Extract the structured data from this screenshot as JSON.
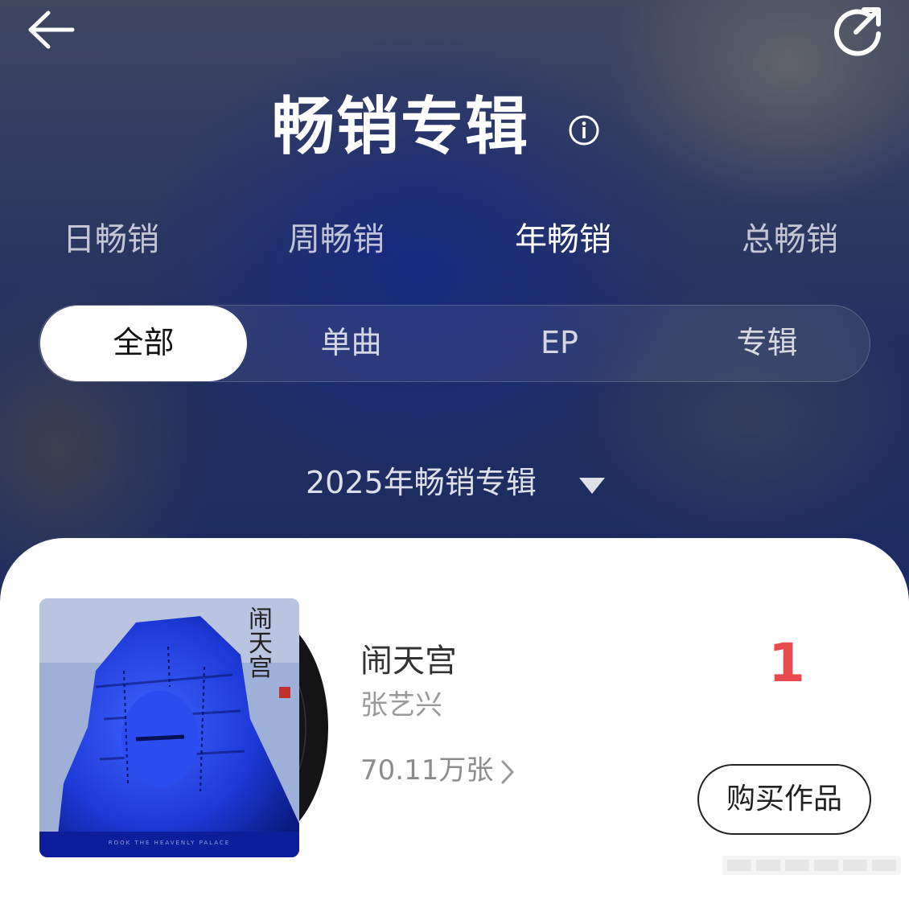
{
  "header": {
    "title": "畅销专辑",
    "back_icon": "back-arrow-icon",
    "share_icon": "share-icon",
    "info_icon": "info-icon"
  },
  "period_tabs": [
    {
      "label": "日畅销",
      "active": false
    },
    {
      "label": "周畅销",
      "active": false
    },
    {
      "label": "年畅销",
      "active": true
    },
    {
      "label": "总畅销",
      "active": false
    }
  ],
  "type_filter": [
    {
      "label": "全部",
      "active": true
    },
    {
      "label": "单曲",
      "active": false
    },
    {
      "label": "EP",
      "active": false
    },
    {
      "label": "专辑",
      "active": false
    }
  ],
  "year_select": {
    "value": "2025年畅销专辑"
  },
  "list": [
    {
      "title": "闹天宫",
      "artist": "张艺兴",
      "sales": "70.11万张",
      "rank": "1",
      "buy_label": "购买作品",
      "cover_text": "闹天宫",
      "cover_subtitle": "ROOK THE HEAVENLY PALACE"
    }
  ],
  "colors": {
    "accent_rank": "#e94a4f",
    "background_blue": "#1a2b62",
    "card": "#ffffff",
    "cover_blue": "#1f3de0"
  }
}
